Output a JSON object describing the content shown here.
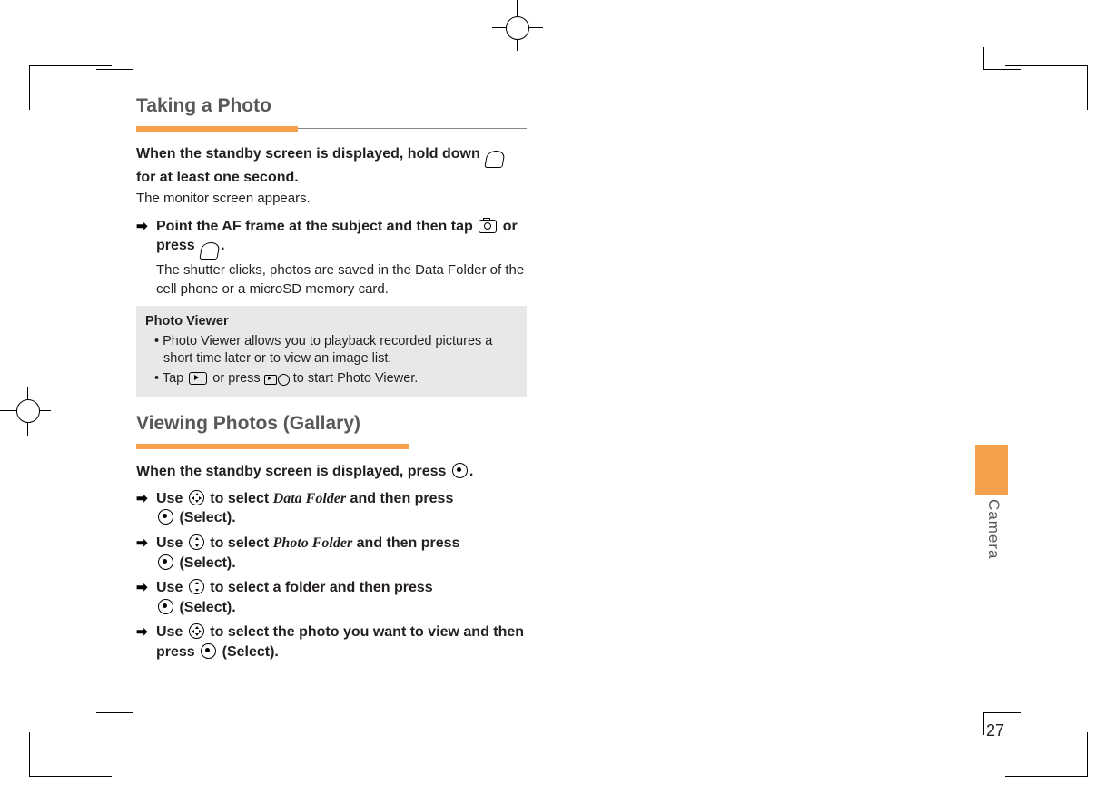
{
  "sideTab": "Camera",
  "pageNumber": "27",
  "section1": {
    "title": "Taking a Photo",
    "intro_bold_1": "When the standby screen is displayed, hold down",
    "intro_bold_2": "for at least one second.",
    "intro_plain": "The monitor screen appears.",
    "step1a": "Point the AF frame at the subject and then tap",
    "step1b": "or press",
    "step1_end": ".",
    "step1_note": "The shutter clicks, photos are saved in the Data Folder of the cell phone or a microSD memory card.",
    "noteTitle": "Photo Viewer",
    "note1": "Photo Viewer allows you to playback recorded pictures a short time later or to view an image list.",
    "note2a": "Tap",
    "note2b": "or press",
    "note2c": "to start Photo Viewer."
  },
  "section2": {
    "title": "Viewing Photos (Gallary)",
    "intro_bold_a": "When the standby screen is displayed, press",
    "intro_bold_end": ".",
    "step1a": "Use",
    "step1b": "to select",
    "step1_italic": "Data Folder",
    "step1c": "and then press",
    "step1d": "(Select).",
    "step2a": "Use",
    "step2b": "to select",
    "step2_italic": "Photo Folder",
    "step2c": "and then press",
    "step2d": "(Select).",
    "step3a": "Use",
    "step3b": "to select a folder and then press",
    "step3c": "(Select).",
    "step4a": "Use",
    "step4b": "to select the photo you want to view and then press",
    "step4c": "(Select)."
  }
}
